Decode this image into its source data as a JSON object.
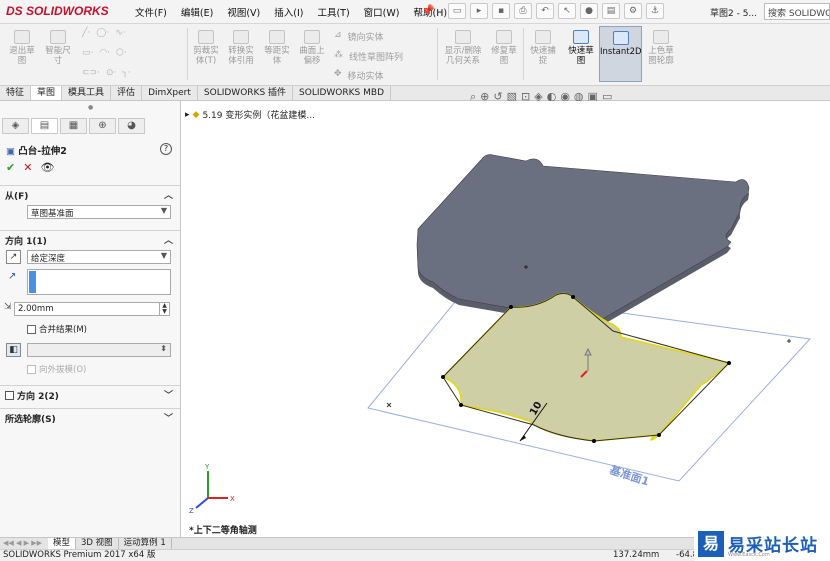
{
  "app": {
    "logo_prefix": "DS",
    "logo": "SOLIDWORKS",
    "menus": [
      "文件(F)",
      "编辑(E)",
      "视图(V)",
      "插入(I)",
      "工具(T)",
      "窗口(W)",
      "帮助(H)"
    ],
    "doc_title": "草图2 - 5...",
    "search_placeholder": "搜索 SOLIDWORKS"
  },
  "command_manager": {
    "left_tools": [
      {
        "label": "退出草\n图",
        "icon": "exit-sketch-icon"
      },
      {
        "label": "智能尺\n寸",
        "icon": "smart-dimension-icon"
      }
    ],
    "mid_tools": [
      {
        "label": "剪裁实\n体(T)",
        "icon": "trim-icon"
      },
      {
        "label": "转换实\n体引用",
        "icon": "convert-icon"
      },
      {
        "label": "等距实\n体",
        "icon": "offset-icon"
      },
      {
        "label": "曲面上\n偏移",
        "icon": "surface-offset-icon"
      }
    ],
    "small_items": [
      "镜向实体",
      "线性草图阵列",
      "移动实体"
    ],
    "right_tools": [
      {
        "label": "显示/删除\n几何关系",
        "icon": "relations-icon"
      },
      {
        "label": "修复草\n图",
        "icon": "repair-icon"
      },
      {
        "label": "快速捕\n捉",
        "icon": "snap-icon"
      },
      {
        "label": "快速草\n图",
        "icon": "rapid-sketch-icon"
      },
      {
        "label": "Instant2D",
        "icon": "instant2d-icon"
      },
      {
        "label": "上色草\n图轮廓",
        "icon": "shade-sketch-icon"
      }
    ]
  },
  "tabs": [
    "特征",
    "草图",
    "模具工具",
    "评估",
    "DimXpert",
    "SOLIDWORKS 插件",
    "SOLIDWORKS MBD"
  ],
  "active_tab": "草图",
  "property_manager": {
    "title": "凸台-拉伸2",
    "from_label": "从(F)",
    "from_value": "草图基准面",
    "dir1_label": "方向 1(1)",
    "dir1_value": "给定深度",
    "depth": "2.00mm",
    "merge_label": "合并结果(M)",
    "draft_label": "向外拔模(O)",
    "dir2_label": "方向 2(2)",
    "contours_label": "所选轮廓(S)"
  },
  "graphics": {
    "tree_item": "5.19 变形实例（花盆建模...",
    "view_label": "*上下二等角轴测",
    "plane_label": "基准面1",
    "dim_text": "10",
    "colors": {
      "top_plate": "#6b7080",
      "sketch_face": "#c8c8a0",
      "sketch_edge": "#f0e000",
      "plane_edge": "#8fa8e0"
    }
  },
  "bottom_tabs": [
    "模型",
    "3D 视图",
    "运动算例 1"
  ],
  "status": {
    "left": "SOLIDWORKS Premium 2017 x64 版",
    "mid": "137.24mm",
    "right": "-64.8"
  },
  "watermark": {
    "icon": "易",
    "text": "易采站长站",
    "sub": "Www.Easck.Com"
  }
}
